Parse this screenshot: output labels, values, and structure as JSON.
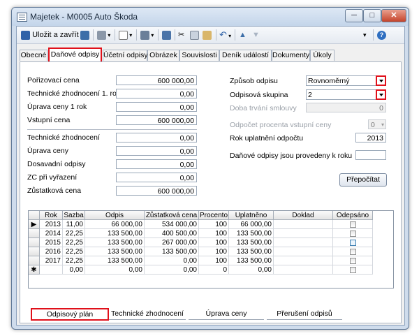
{
  "window": {
    "title": "Majetek - M0005 Auto Škoda",
    "controls": {
      "minimize": "─",
      "maximize": "□",
      "close": "✕"
    }
  },
  "toolbar": {
    "save_close_label": "Uložit a zavřít",
    "icons": [
      "save-icon",
      "disk-icon",
      "print-icon",
      "preview-icon",
      "copy-record-icon",
      "new-record-icon",
      "cut-icon",
      "copy-icon",
      "paste-icon",
      "undo-icon",
      "up-icon",
      "down-icon",
      "help-icon"
    ]
  },
  "tabs": [
    "Obecné",
    "Daňové odpisy",
    "Účetní odpisy",
    "Obrázek",
    "Souvislosti",
    "Deník událostí",
    "Dokumenty",
    "Úkoly"
  ],
  "form": {
    "porizovaci_cena": {
      "label": "Pořizovací cena",
      "value": "600 000,00"
    },
    "tech_zhodnoceni_1rok": {
      "label": "Technické zhodnocení 1. rok",
      "value": "0,00"
    },
    "uprava_ceny_1rok": {
      "label": "Úprava ceny 1 rok",
      "value": "0,00"
    },
    "vstupni_cena": {
      "label": "Vstupní cena",
      "value": "600 000,00"
    },
    "tech_zhodnoceni": {
      "label": "Technické zhodnocení",
      "value": "0,00"
    },
    "uprava_ceny": {
      "label": "Úprava ceny",
      "value": "0,00"
    },
    "dosavadni_odpisy": {
      "label": "Dosavadní odpisy",
      "value": "0,00"
    },
    "zc_pri_vyrazeni": {
      "label": "ZC při vyřazení",
      "value": "0,00"
    },
    "zustatkova_cena": {
      "label": "Zůstatková cena",
      "value": "600 000,00"
    },
    "zpusob_odpisu": {
      "label": "Způsob odpisu",
      "value": "Rovnoměrný"
    },
    "odpisova_skupina": {
      "label": "Odpisová skupina",
      "value": "2"
    },
    "doba_trvani_smlouvy": {
      "label": "Doba trvání smlouvy",
      "value": "0"
    },
    "odpocet_procenta": {
      "label": "Odpočet procenta vstupní ceny",
      "value": "0"
    },
    "rok_uplatneni": {
      "label": "Rok uplatnění odpočtu",
      "value": "2013"
    },
    "danove_odpisy_provedeny": {
      "label": "Daňové odpisy jsou provedeny k roku",
      "value": ""
    },
    "prepocitat_label": "Přepočítat"
  },
  "grid": {
    "columns": [
      "Rok",
      "Sazba",
      "Odpis",
      "Zůstatková cena",
      "Procento",
      "Uplatněno",
      "Doklad",
      "Odepsáno"
    ],
    "rows": [
      {
        "rok": "2013",
        "sazba": "11,00",
        "odpis": "66 000,00",
        "zustatkova": "534 000,00",
        "procento": "100",
        "uplatneno": "66 000,00"
      },
      {
        "rok": "2014",
        "sazba": "22,25",
        "odpis": "133 500,00",
        "zustatkova": "400 500,00",
        "procento": "100",
        "uplatneno": "133 500,00"
      },
      {
        "rok": "2015",
        "sazba": "22,25",
        "odpis": "133 500,00",
        "zustatkova": "267 000,00",
        "procento": "100",
        "uplatneno": "133 500,00"
      },
      {
        "rok": "2016",
        "sazba": "22,25",
        "odpis": "133 500,00",
        "zustatkova": "133 500,00",
        "procento": "100",
        "uplatneno": "133 500,00"
      },
      {
        "rok": "2017",
        "sazba": "22,25",
        "odpis": "133 500,00",
        "zustatkova": "0,00",
        "procento": "100",
        "uplatneno": "133 500,00"
      }
    ],
    "new_row": {
      "marker": "✱",
      "sazba": "0,00",
      "odpis": "0,00",
      "zustatkova": "0,00",
      "procento": "0",
      "uplatneno": "0,00"
    },
    "current_row_marker": "▶"
  },
  "bottom_tabs": [
    "Odpisový plán",
    "Technické zhodnocení",
    "Úprava ceny",
    "Přerušení odpisů"
  ],
  "colors": {
    "highlight": "#e0101a",
    "accent": "#3c6ea8"
  }
}
